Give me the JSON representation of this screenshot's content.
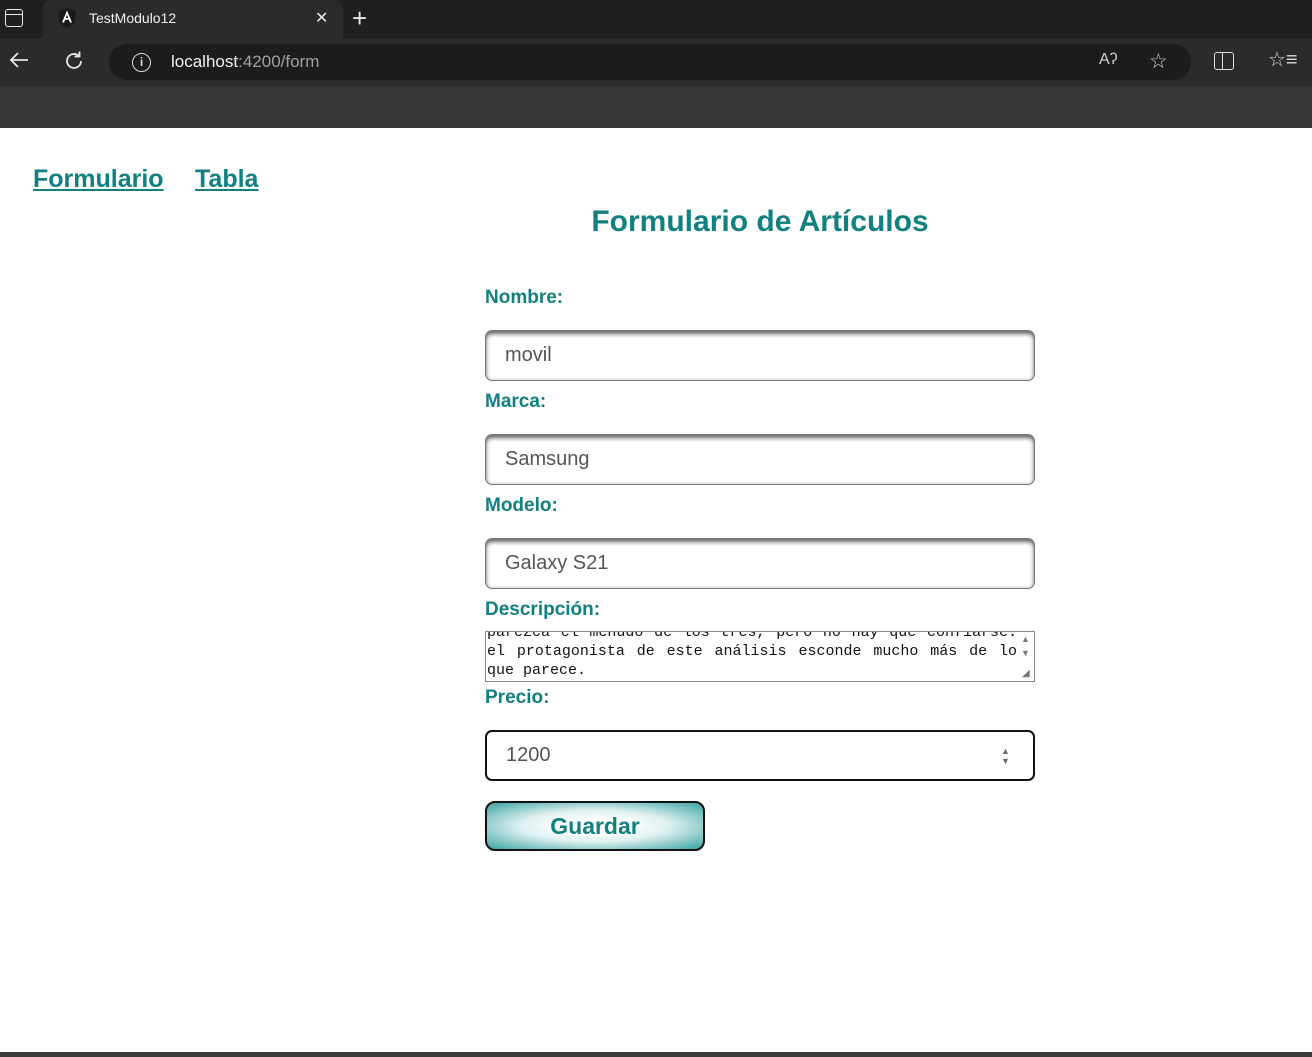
{
  "browser": {
    "tab_title": "TestModulo12",
    "tab_close": "✕",
    "new_tab": "+",
    "url_host": "localhost",
    "url_path": ":4200/form",
    "info_icon": "i",
    "read_aloud": "Aʔ",
    "favorite_star": "☆",
    "favorites_menu": "☆≡"
  },
  "nav": {
    "form_link": "Formulario",
    "table_link": "Tabla"
  },
  "form": {
    "title": "Formulario de Artículos",
    "nombre_label": "Nombre:",
    "nombre_value": "movil",
    "marca_label": "Marca:",
    "marca_value": "Samsung",
    "modelo_label": "Modelo:",
    "modelo_value": "Galaxy S21",
    "descripcion_label": "Descripción:",
    "descripcion_value": "parezca el menudo de los tres, pero no hay que confiarse. el protagonista de este análisis esconde mucho más de lo que parece.",
    "precio_label": "Precio:",
    "precio_value": "1200",
    "save_label": "Guardar"
  },
  "colors": {
    "accent": "#118080",
    "chrome_dark": "#202020",
    "chrome_toolbar": "#2b2b2b"
  }
}
